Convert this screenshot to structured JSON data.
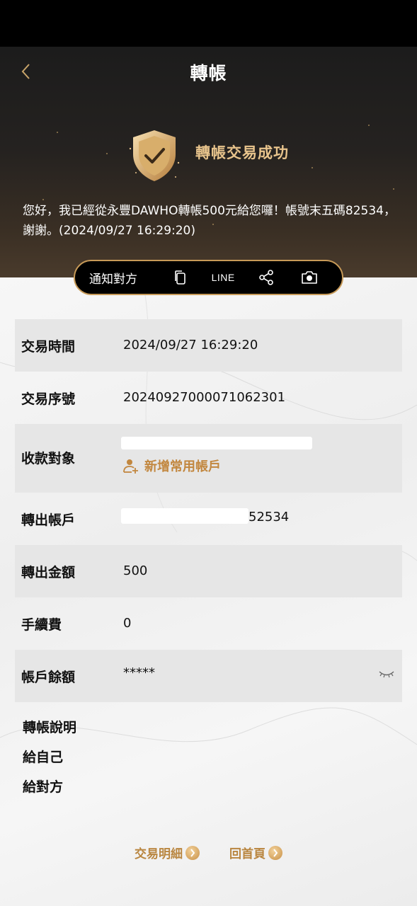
{
  "header": {
    "title": "轉帳"
  },
  "result": {
    "title": "轉帳交易成功",
    "message": "您好，我已經從永豐DAWHO轉帳500元給您囉！帳號末五碼82534，謝謝。(2024/09/27 16:29:20)"
  },
  "share_bar": {
    "notify_label": "通知對方",
    "line_label": "LINE"
  },
  "details": {
    "time_label": "交易時間",
    "time_value": "2024/09/27 16:29:20",
    "serial_label": "交易序號",
    "serial_value": "20240927000071062301",
    "payee_label": "收款對象",
    "add_favorite_label": "新增常用帳戶",
    "from_account_label": "轉出帳戶",
    "from_account_value": "52534",
    "amount_label": "轉出金額",
    "amount_value": "500",
    "fee_label": "手續費",
    "fee_value": "0",
    "balance_label": "帳戶餘額",
    "balance_value": "*****"
  },
  "notes": {
    "transfer_note_label": "轉帳說明",
    "to_self_label": "給自己",
    "to_payee_label": "給對方"
  },
  "footer": {
    "details_link": "交易明細",
    "home_link": "回首頁"
  },
  "colors": {
    "accent_gold": "#c2873f",
    "success_gold": "#e8c48c"
  }
}
